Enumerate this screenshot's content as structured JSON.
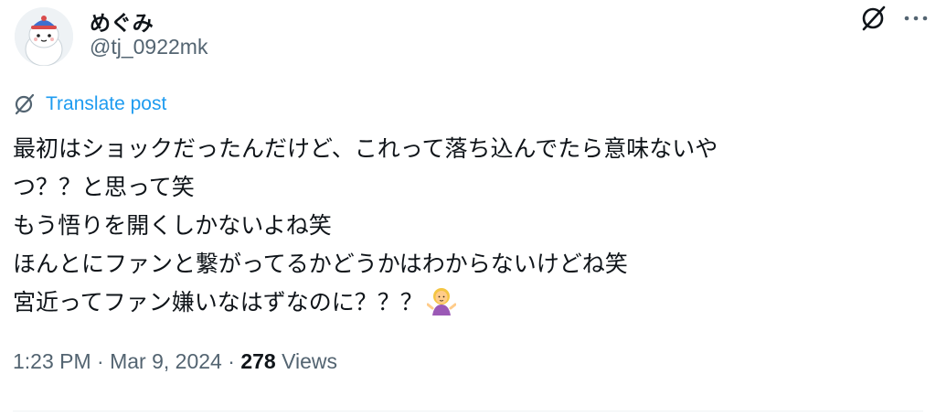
{
  "author": {
    "name": "めぐみ",
    "handle": "@tj_0922mk"
  },
  "actions": {
    "grok_icon": "grok-icon",
    "more_icon": "more-icon"
  },
  "translate": {
    "label": "Translate post"
  },
  "post": {
    "lines": [
      "最初はショックだったんだけど、これって落ち込んでたら意味ないや",
      "つ？？と思って笑",
      "もう悟りを開くしかないよね笑",
      "ほんとにファンと繋がってるかどうかはわからないけどね笑",
      "宮近ってファン嫌いなはずなのに？？？"
    ],
    "emoji": "woman-shrugging-emoji"
  },
  "meta": {
    "time": "1:23 PM",
    "separator": "·",
    "date": "Mar 9, 2024",
    "views_count": "278",
    "views_label": "Views"
  },
  "colors": {
    "text": "#0f1419",
    "secondary": "#536471",
    "link": "#1d9bf0"
  }
}
